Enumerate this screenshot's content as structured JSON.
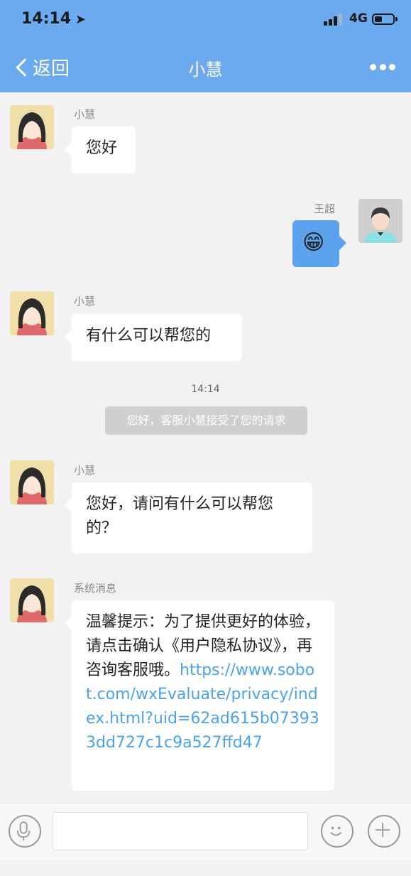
{
  "status_bar": {
    "time": "14:14",
    "network": "4G"
  },
  "navbar": {
    "back_label": "返回",
    "title": "小慧"
  },
  "messages": [
    {
      "sender": "小慧",
      "text": "您好"
    },
    {
      "sender": "王超",
      "emoji": "😁"
    },
    {
      "sender": "小慧",
      "text": "有什么可以帮您的"
    },
    {
      "sender": "小慧",
      "text": "您好，请问有什么可以帮您的？"
    },
    {
      "sender": "系统消息",
      "text": "温馨提示：为了提供更好的体验，请点击确认《用户隐私协议》，再咨询客服哦。",
      "link": "https://www.sobot.com/wxEvaluate/privacy/index.html?uid=62ad615b073933dd727c1c9a527ffd47"
    }
  ],
  "timestamp": "14:14",
  "notice": "您好，客服小慧接受了您的请求",
  "input": {
    "placeholder": ""
  },
  "icons": {
    "back": "chevron-left-icon",
    "more": "ellipsis-icon",
    "mic": "microphone-icon",
    "emoji": "smile-icon",
    "plus": "plus-icon"
  },
  "colors": {
    "header": "#6caaf0",
    "bubble_right": "#5da2ed",
    "link": "#4aa3ec"
  }
}
